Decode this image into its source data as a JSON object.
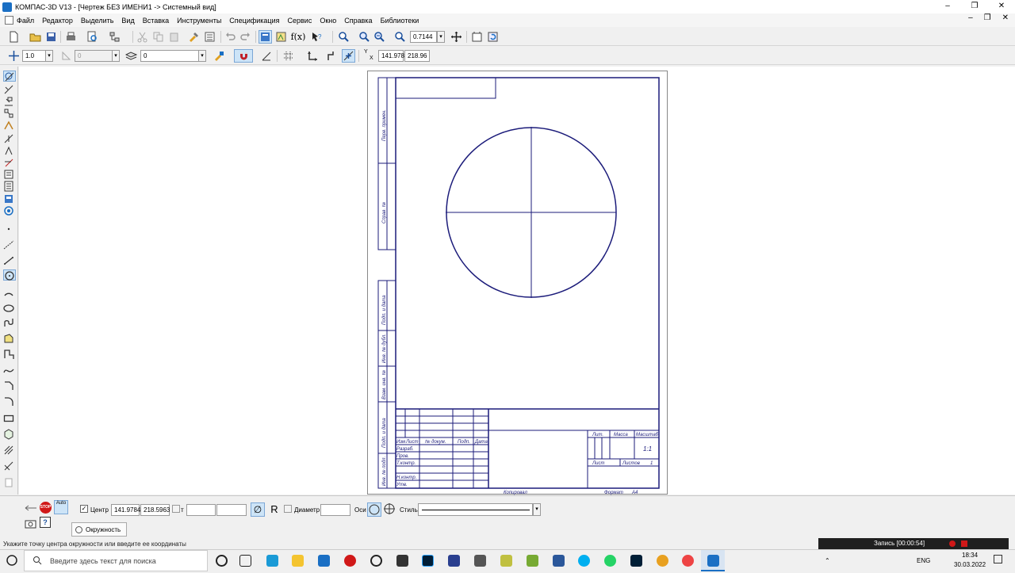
{
  "window": {
    "title": "КОМПАС-3D V13 - [Чертеж БЕЗ ИМЕНИ1 -> Системный вид]",
    "controls": [
      "–",
      "❐",
      "✕"
    ]
  },
  "menu": {
    "items": [
      "Файл",
      "Редактор",
      "Выделить",
      "Вид",
      "Вставка",
      "Инструменты",
      "Спецификация",
      "Сервис",
      "Окно",
      "Справка",
      "Библиотеки"
    ],
    "mdi_controls": [
      "–",
      "❐",
      "✕"
    ]
  },
  "toolbar1": {
    "fx_label": "f(x)",
    "zoom_value": "0.7144"
  },
  "toolbar2": {
    "step_value": "1.0",
    "angle_value": "0",
    "layer_value": "0",
    "coord_x": "141.978",
    "coord_y": "218.96",
    "x_label": "X",
    "y_label": "Y"
  },
  "drawing": {
    "side_labels": [
      "Перв. примен.",
      "Справ. №",
      "Подп. и дата",
      "Инв. № дубл.",
      "Взам. инв. №",
      "Подп. и дата",
      "Инв. № подл."
    ],
    "stamp_headers": [
      "Изм",
      "Лист",
      "№ докум.",
      "Подп.",
      "Дата"
    ],
    "stamp_rows": [
      "Разраб.",
      "Пров.",
      "Т.контр.",
      "",
      "Н.контр.",
      "Утв."
    ],
    "stamp_right_headers": [
      "Лит.",
      "Масса",
      "Масштаб"
    ],
    "scale_value": "1:1",
    "sheet_label": "Лист",
    "sheets_label": "Листов",
    "sheets_value": "1",
    "copied": "Копировал",
    "format_label": "Формат",
    "format_value": "A4"
  },
  "props_panel": {
    "auto_label": "Auto",
    "stop_label": "STOP",
    "center_label": "Центр",
    "center_x": "141.9784",
    "center_y": "218.5963",
    "point_label": "т",
    "r_label": "R",
    "diameter_label": "Диаметр",
    "axes_label": "Оси",
    "style_label": "Стиль",
    "tab_label": "Окружность"
  },
  "status_bar": {
    "text": "Укажите точку центра окружности или введите ее координаты"
  },
  "taskbar": {
    "search_placeholder": "Введите здесь текст для поиска",
    "recording": "Запись [00:00:54]",
    "lang": "ENG",
    "time": "18:34",
    "date": "30.03.2022"
  },
  "colors": {
    "drawing_line": "#1b1b7a",
    "accent": "#1a6fc4"
  }
}
